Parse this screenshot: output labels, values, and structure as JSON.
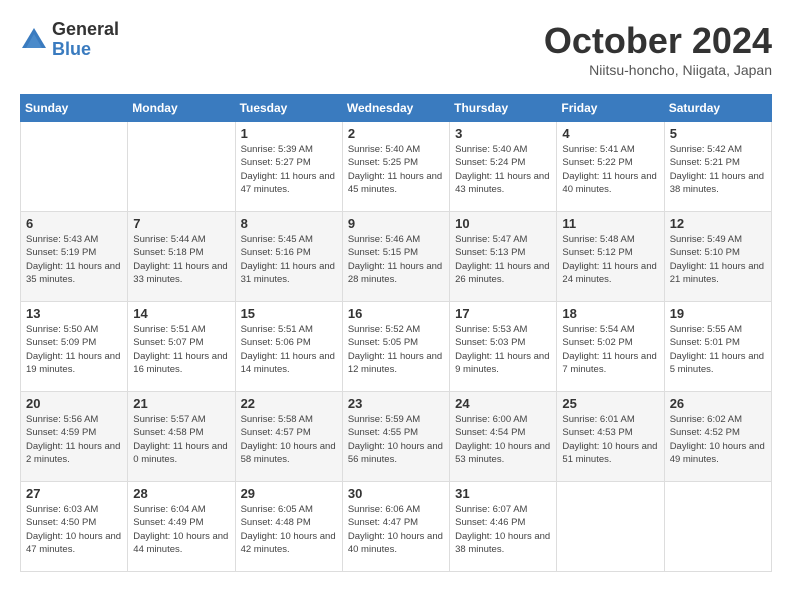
{
  "logo": {
    "general": "General",
    "blue": "Blue"
  },
  "header": {
    "month": "October 2024",
    "location": "Niitsu-honcho, Niigata, Japan"
  },
  "weekdays": [
    "Sunday",
    "Monday",
    "Tuesday",
    "Wednesday",
    "Thursday",
    "Friday",
    "Saturday"
  ],
  "weeks": [
    [
      {
        "day": "",
        "sunrise": "",
        "sunset": "",
        "daylight": ""
      },
      {
        "day": "",
        "sunrise": "",
        "sunset": "",
        "daylight": ""
      },
      {
        "day": "1",
        "sunrise": "Sunrise: 5:39 AM",
        "sunset": "Sunset: 5:27 PM",
        "daylight": "Daylight: 11 hours and 47 minutes."
      },
      {
        "day": "2",
        "sunrise": "Sunrise: 5:40 AM",
        "sunset": "Sunset: 5:25 PM",
        "daylight": "Daylight: 11 hours and 45 minutes."
      },
      {
        "day": "3",
        "sunrise": "Sunrise: 5:40 AM",
        "sunset": "Sunset: 5:24 PM",
        "daylight": "Daylight: 11 hours and 43 minutes."
      },
      {
        "day": "4",
        "sunrise": "Sunrise: 5:41 AM",
        "sunset": "Sunset: 5:22 PM",
        "daylight": "Daylight: 11 hours and 40 minutes."
      },
      {
        "day": "5",
        "sunrise": "Sunrise: 5:42 AM",
        "sunset": "Sunset: 5:21 PM",
        "daylight": "Daylight: 11 hours and 38 minutes."
      }
    ],
    [
      {
        "day": "6",
        "sunrise": "Sunrise: 5:43 AM",
        "sunset": "Sunset: 5:19 PM",
        "daylight": "Daylight: 11 hours and 35 minutes."
      },
      {
        "day": "7",
        "sunrise": "Sunrise: 5:44 AM",
        "sunset": "Sunset: 5:18 PM",
        "daylight": "Daylight: 11 hours and 33 minutes."
      },
      {
        "day": "8",
        "sunrise": "Sunrise: 5:45 AM",
        "sunset": "Sunset: 5:16 PM",
        "daylight": "Daylight: 11 hours and 31 minutes."
      },
      {
        "day": "9",
        "sunrise": "Sunrise: 5:46 AM",
        "sunset": "Sunset: 5:15 PM",
        "daylight": "Daylight: 11 hours and 28 minutes."
      },
      {
        "day": "10",
        "sunrise": "Sunrise: 5:47 AM",
        "sunset": "Sunset: 5:13 PM",
        "daylight": "Daylight: 11 hours and 26 minutes."
      },
      {
        "day": "11",
        "sunrise": "Sunrise: 5:48 AM",
        "sunset": "Sunset: 5:12 PM",
        "daylight": "Daylight: 11 hours and 24 minutes."
      },
      {
        "day": "12",
        "sunrise": "Sunrise: 5:49 AM",
        "sunset": "Sunset: 5:10 PM",
        "daylight": "Daylight: 11 hours and 21 minutes."
      }
    ],
    [
      {
        "day": "13",
        "sunrise": "Sunrise: 5:50 AM",
        "sunset": "Sunset: 5:09 PM",
        "daylight": "Daylight: 11 hours and 19 minutes."
      },
      {
        "day": "14",
        "sunrise": "Sunrise: 5:51 AM",
        "sunset": "Sunset: 5:07 PM",
        "daylight": "Daylight: 11 hours and 16 minutes."
      },
      {
        "day": "15",
        "sunrise": "Sunrise: 5:51 AM",
        "sunset": "Sunset: 5:06 PM",
        "daylight": "Daylight: 11 hours and 14 minutes."
      },
      {
        "day": "16",
        "sunrise": "Sunrise: 5:52 AM",
        "sunset": "Sunset: 5:05 PM",
        "daylight": "Daylight: 11 hours and 12 minutes."
      },
      {
        "day": "17",
        "sunrise": "Sunrise: 5:53 AM",
        "sunset": "Sunset: 5:03 PM",
        "daylight": "Daylight: 11 hours and 9 minutes."
      },
      {
        "day": "18",
        "sunrise": "Sunrise: 5:54 AM",
        "sunset": "Sunset: 5:02 PM",
        "daylight": "Daylight: 11 hours and 7 minutes."
      },
      {
        "day": "19",
        "sunrise": "Sunrise: 5:55 AM",
        "sunset": "Sunset: 5:01 PM",
        "daylight": "Daylight: 11 hours and 5 minutes."
      }
    ],
    [
      {
        "day": "20",
        "sunrise": "Sunrise: 5:56 AM",
        "sunset": "Sunset: 4:59 PM",
        "daylight": "Daylight: 11 hours and 2 minutes."
      },
      {
        "day": "21",
        "sunrise": "Sunrise: 5:57 AM",
        "sunset": "Sunset: 4:58 PM",
        "daylight": "Daylight: 11 hours and 0 minutes."
      },
      {
        "day": "22",
        "sunrise": "Sunrise: 5:58 AM",
        "sunset": "Sunset: 4:57 PM",
        "daylight": "Daylight: 10 hours and 58 minutes."
      },
      {
        "day": "23",
        "sunrise": "Sunrise: 5:59 AM",
        "sunset": "Sunset: 4:55 PM",
        "daylight": "Daylight: 10 hours and 56 minutes."
      },
      {
        "day": "24",
        "sunrise": "Sunrise: 6:00 AM",
        "sunset": "Sunset: 4:54 PM",
        "daylight": "Daylight: 10 hours and 53 minutes."
      },
      {
        "day": "25",
        "sunrise": "Sunrise: 6:01 AM",
        "sunset": "Sunset: 4:53 PM",
        "daylight": "Daylight: 10 hours and 51 minutes."
      },
      {
        "day": "26",
        "sunrise": "Sunrise: 6:02 AM",
        "sunset": "Sunset: 4:52 PM",
        "daylight": "Daylight: 10 hours and 49 minutes."
      }
    ],
    [
      {
        "day": "27",
        "sunrise": "Sunrise: 6:03 AM",
        "sunset": "Sunset: 4:50 PM",
        "daylight": "Daylight: 10 hours and 47 minutes."
      },
      {
        "day": "28",
        "sunrise": "Sunrise: 6:04 AM",
        "sunset": "Sunset: 4:49 PM",
        "daylight": "Daylight: 10 hours and 44 minutes."
      },
      {
        "day": "29",
        "sunrise": "Sunrise: 6:05 AM",
        "sunset": "Sunset: 4:48 PM",
        "daylight": "Daylight: 10 hours and 42 minutes."
      },
      {
        "day": "30",
        "sunrise": "Sunrise: 6:06 AM",
        "sunset": "Sunset: 4:47 PM",
        "daylight": "Daylight: 10 hours and 40 minutes."
      },
      {
        "day": "31",
        "sunrise": "Sunrise: 6:07 AM",
        "sunset": "Sunset: 4:46 PM",
        "daylight": "Daylight: 10 hours and 38 minutes."
      },
      {
        "day": "",
        "sunrise": "",
        "sunset": "",
        "daylight": ""
      },
      {
        "day": "",
        "sunrise": "",
        "sunset": "",
        "daylight": ""
      }
    ]
  ]
}
